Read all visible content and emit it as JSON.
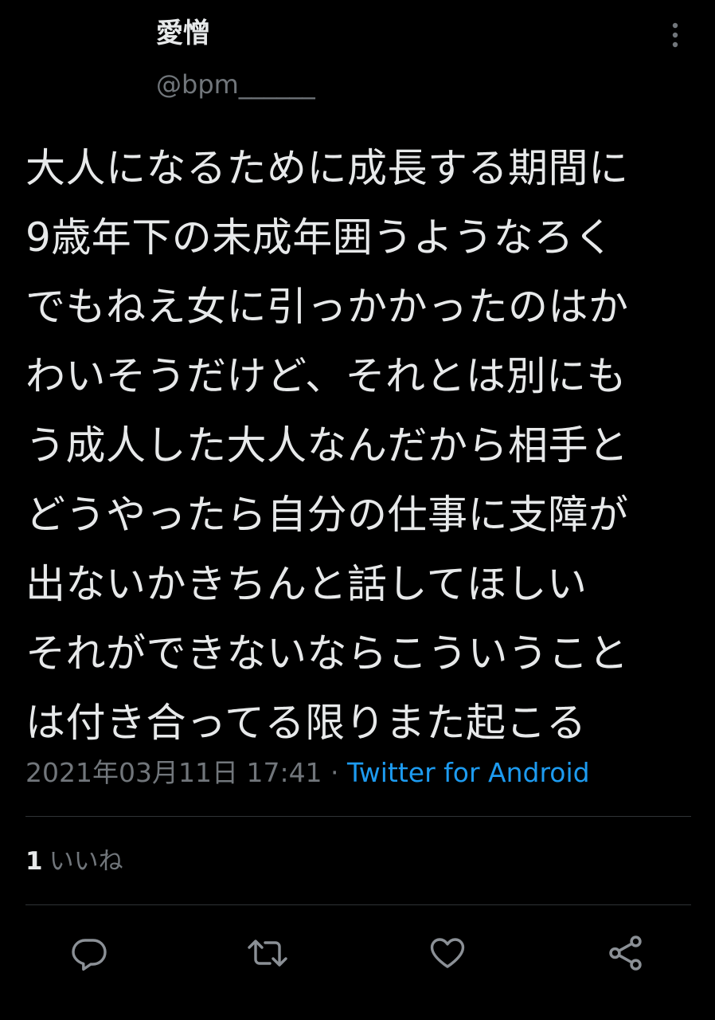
{
  "author": {
    "display_name": "愛憎",
    "handle": "@bpm______"
  },
  "tweet": {
    "lines": [
      "大人になるために成長する期間に",
      "9歳年下の未成年囲うようなろく",
      "でもねえ女に引っかかったのはか",
      "わいそうだけど、それとは別にも",
      "う成人した大人なんだから相手と",
      "どうやったら自分の仕事に支障が",
      "出ないかきちんと話してほしい",
      "それができないならこういうこと",
      "は付き合ってる限りまた起こる"
    ],
    "timestamp": "2021年03月11日 17:41",
    "separator": " · ",
    "source": "Twitter for Android"
  },
  "stats": {
    "likes_count": "1",
    "likes_label": "いいね"
  },
  "icons": {
    "more": "more-vertical-icon",
    "reply": "reply-icon",
    "retweet": "retweet-icon",
    "like": "heart-icon",
    "share": "share-icon"
  },
  "colors": {
    "background": "#000000",
    "text": "#e7e9ea",
    "secondary": "#71767b",
    "link": "#1d9bf0",
    "divider": "#2f3336"
  }
}
